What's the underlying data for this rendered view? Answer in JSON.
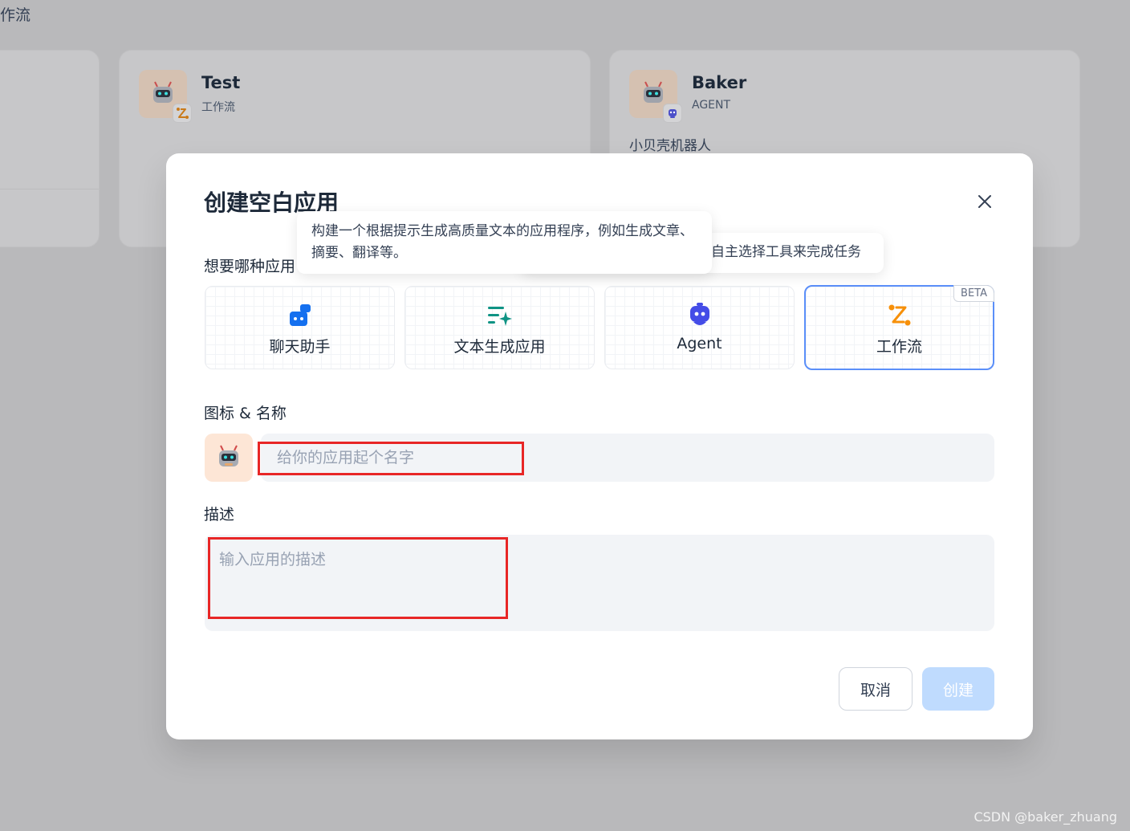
{
  "background": {
    "page_title": "作流",
    "cards": [
      {
        "name": "Test",
        "type": "工作流",
        "desc": ""
      },
      {
        "name": "Baker",
        "type": "AGENT",
        "desc": "小贝壳机器人"
      }
    ]
  },
  "modal": {
    "title": "创建空白应用",
    "type_question": "想要哪种应用",
    "app_types": [
      {
        "label": "聊天助手",
        "icon": "chat-bubbles-icon",
        "selected": false
      },
      {
        "label": "文本生成应用",
        "icon": "text-generation-icon",
        "selected": false
      },
      {
        "label": "Agent",
        "icon": "agent-robot-icon",
        "selected": false
      },
      {
        "label": "工作流",
        "icon": "workflow-icon",
        "selected": true,
        "badge": "BETA"
      }
    ],
    "name_section_label": "图标 & 名称",
    "name_placeholder": "给你的应用起个名字",
    "name_value": "",
    "desc_section_label": "描述",
    "desc_placeholder": "输入应用的描述",
    "desc_value": "",
    "cancel_label": "取消",
    "create_label": "创建",
    "create_enabled": false
  },
  "tooltips": {
    "text_generation": "构建一个根据提示生成高质量文本的应用程序，例如生成文章、摘要、翻译等。",
    "agent": "自主选择工具来完成任务"
  },
  "colors": {
    "accent": "#155eef",
    "selected_border": "#5b8ff9",
    "create_disabled": "#bfdbfe",
    "highlight": "#e82626",
    "avatar_bg": "#fde6d6"
  },
  "watermark": "CSDN @baker_zhuang"
}
